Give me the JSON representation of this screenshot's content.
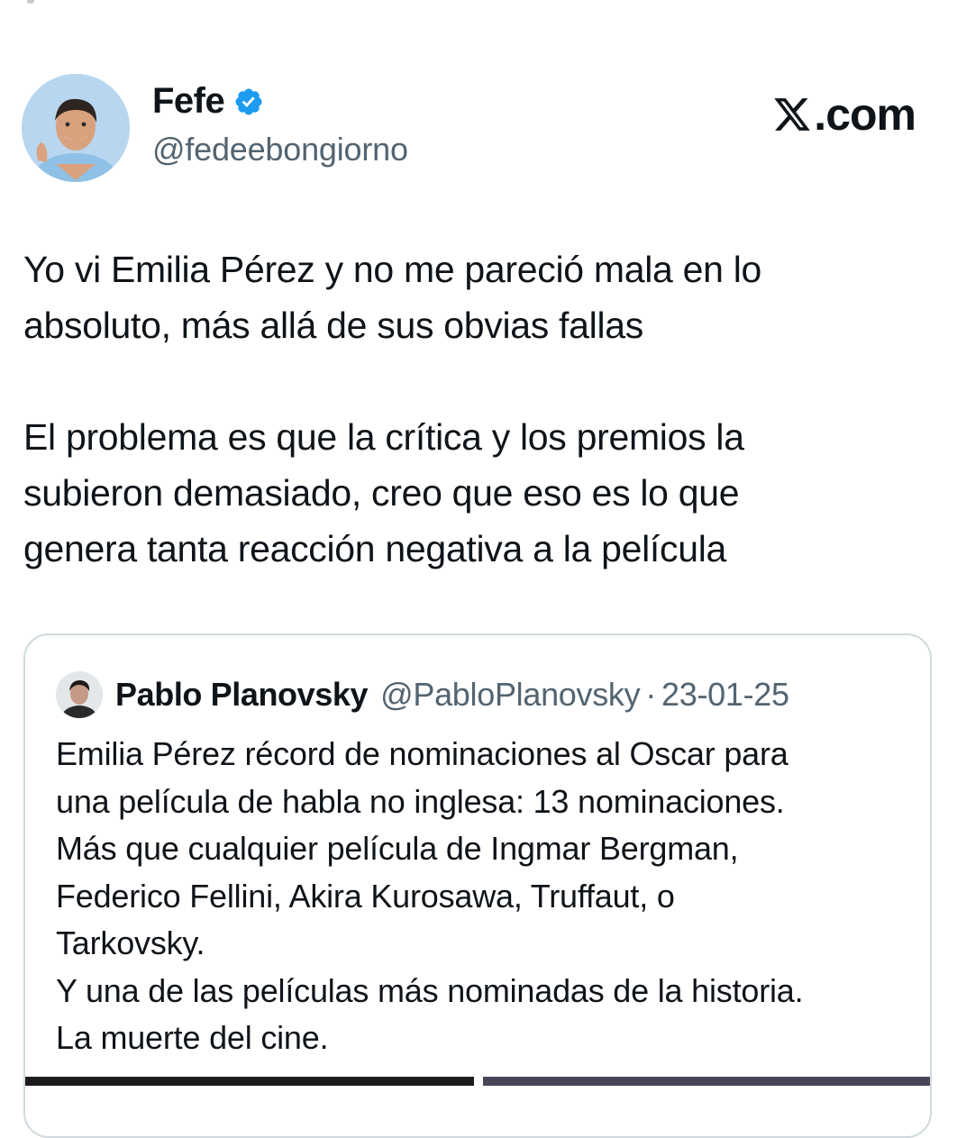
{
  "author": {
    "display_name": "Fefe",
    "handle": "@fedeebongiorno",
    "avatar_icon": "person-photo"
  },
  "brand": {
    "logo": "x-logo-icon",
    "suffix": ".com"
  },
  "tweet": {
    "paragraphs": [
      [
        "Yo vi Emilia Pérez y no me pareció mala en lo",
        "absoluto, más allá de sus obvias fallas"
      ],
      [
        "El problema es que la crítica y los premios la",
        "subieron demasiado, creo que eso es lo que",
        "genera tanta reacción negativa a la película"
      ]
    ]
  },
  "quote": {
    "display_name": "Pablo Planovsky",
    "handle": "@PabloPlanovsky",
    "separator": "·",
    "date": "23-01-25",
    "lines": [
      "Emilia Pérez récord de nominaciones al Oscar para",
      "una película de habla no inglesa: 13 nominaciones.",
      "Más que cualquier película de Ingmar Bergman,",
      "Federico Fellini, Akira Kurosawa, Truffaut, o",
      "Tarkovsky.",
      "Y una de las películas más nominadas de la historia.",
      "La muerte del cine."
    ]
  },
  "colors": {
    "text": "#0f1419",
    "secondary": "#536471",
    "verified": "#1d9bf0",
    "border": "#cfd9de"
  }
}
